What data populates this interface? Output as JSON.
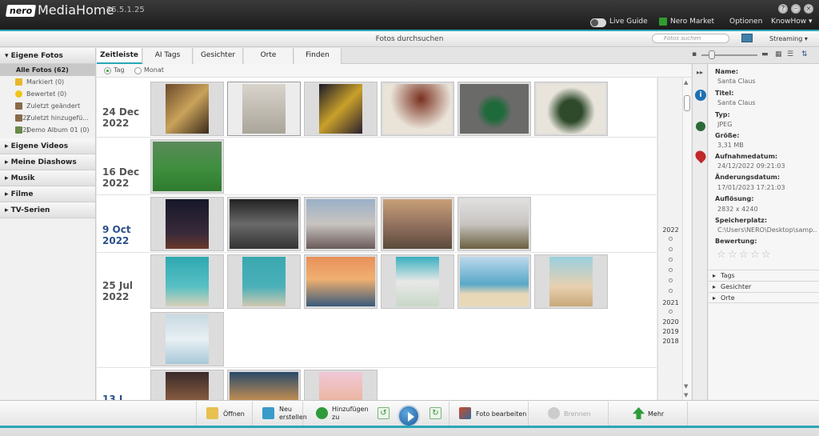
{
  "app": {
    "logo": "nero",
    "name": "MediaHome",
    "version": "25.5.1.25"
  },
  "top_menu": {
    "live_guide": "Live Guide",
    "nero_market": "Nero Market",
    "options": "Optionen",
    "knowhow": "KnowHow ▾"
  },
  "search": {
    "title": "Fotos durchsuchen",
    "placeholder": "Fotos suchen",
    "streaming": "Streaming ▾"
  },
  "sidebar": {
    "eigene_fotos": "Eigene Fotos",
    "items": [
      {
        "label": "Alle Fotos (62)"
      },
      {
        "label": "Markiert (0)"
      },
      {
        "label": "Bewertet (0)"
      },
      {
        "label": "Zuletzt geändert (62)"
      },
      {
        "label": "Zuletzt hinzugefü... (62)"
      },
      {
        "label": "Demo Album 01 (0)"
      }
    ],
    "sections": [
      "Eigene Videos",
      "Meine Diashows",
      "Musik",
      "Filme",
      "TV-Serien"
    ]
  },
  "tabs": [
    "Zeitleiste",
    "AI Tags",
    "Gesichter",
    "Orte",
    "Finden"
  ],
  "view_mode": {
    "day": "Tag",
    "month": "Monat"
  },
  "groups": [
    {
      "date": "24 Dec",
      "year": "2022"
    },
    {
      "date": "16 Dec",
      "year": "2022"
    },
    {
      "date": "9 Oct",
      "year": "2022"
    },
    {
      "date": "25 Jul",
      "year": "2022"
    },
    {
      "date": "13 J",
      "year": "2022"
    }
  ],
  "years": [
    "2022",
    "2021",
    "2020",
    "2019",
    "2018"
  ],
  "info": {
    "name_label": "Name:",
    "name": "Santa Claus",
    "title_label": "Titel:",
    "title": "Santa Claus",
    "type_label": "Typ:",
    "type": "JPEG",
    "size_label": "Größe:",
    "size": "3,31 MB",
    "taken_label": "Aufnahmedatum:",
    "taken": "24/12/2022 09:21:03",
    "modified_label": "Änderungsdatum:",
    "modified": "17/01/2023 17:21:03",
    "resolution_label": "Auflösung:",
    "resolution": "2832 x 4240",
    "location_label": "Speicherplatz:",
    "location": "C:\\Users\\NERO\\Desktop\\samp...",
    "rating_label": "Bewertung:",
    "sections": [
      "Tags",
      "Gesichter",
      "Orte"
    ]
  },
  "actions": {
    "open": "Öffnen",
    "new_create_1": "Neu",
    "new_create_2": "erstellen",
    "add_to_1": "Hinzufügen",
    "add_to_2": "zu",
    "edit_photo": "Foto bearbeiten",
    "burn": "Brennen",
    "more": "Mehr"
  }
}
